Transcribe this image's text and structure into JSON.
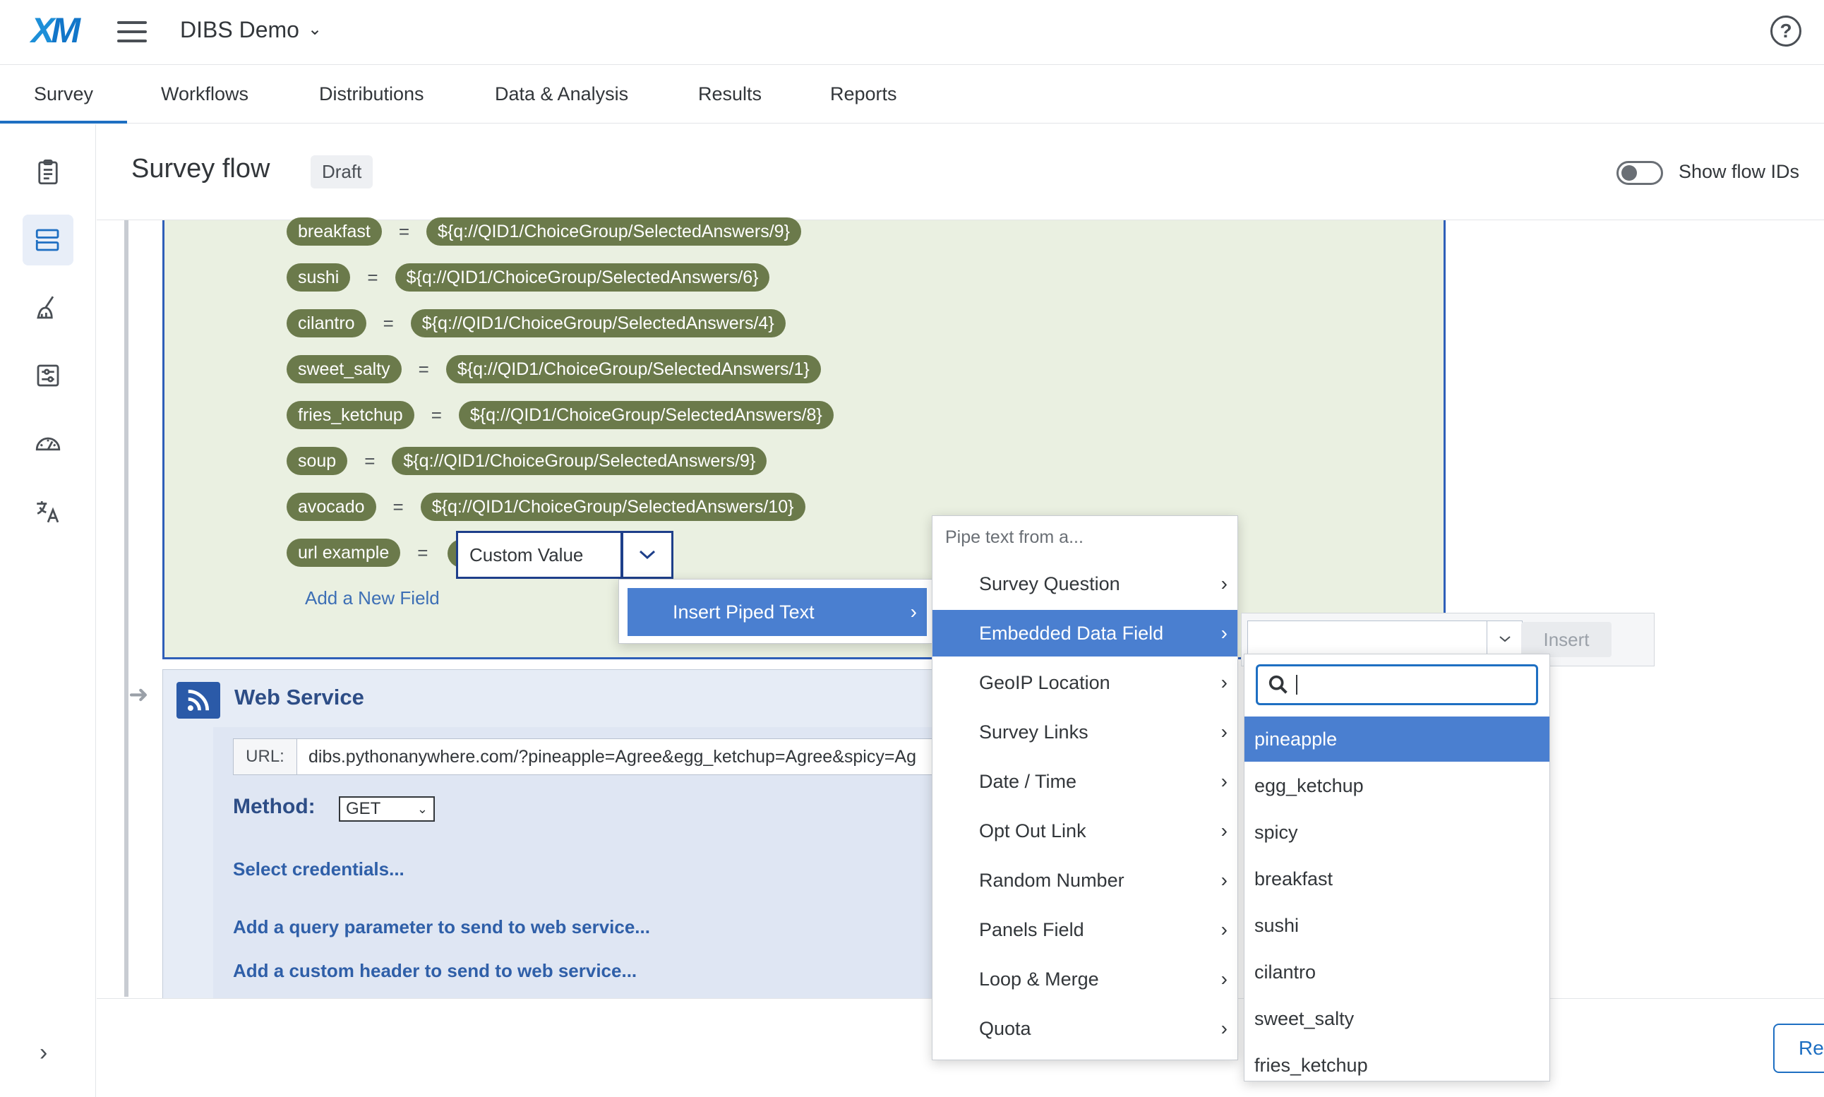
{
  "header": {
    "logo": "XM",
    "project_name": "DIBS Demo",
    "help_label": "?"
  },
  "tabs": [
    "Survey",
    "Workflows",
    "Distributions",
    "Data & Analysis",
    "Results",
    "Reports"
  ],
  "active_tab": "Survey",
  "page": {
    "title": "Survey flow",
    "status_badge": "Draft",
    "toggle_label": "Show flow IDs",
    "toggle_on": false
  },
  "set_embedded": {
    "fields": [
      {
        "name": "breakfast",
        "value": "${q://QID1/ChoiceGroup/SelectedAnswers/9}"
      },
      {
        "name": "sushi",
        "value": "${q://QID1/ChoiceGroup/SelectedAnswers/6}"
      },
      {
        "name": "cilantro",
        "value": "${q://QID1/ChoiceGroup/SelectedAnswers/4}"
      },
      {
        "name": "sweet_salty",
        "value": "${q://QID1/ChoiceGroup/SelectedAnswers/1}"
      },
      {
        "name": "fries_ketchup",
        "value": "${q://QID1/ChoiceGroup/SelectedAnswers/8}"
      },
      {
        "name": "soup",
        "value": "${q://QID1/ChoiceGroup/SelectedAnswers/9}"
      },
      {
        "name": "avocado",
        "value": "${q://QID1/ChoiceGroup/SelectedAnswers/10}"
      }
    ],
    "editing_field": {
      "name": "url example",
      "value": "Custom Value"
    },
    "add_field_label": "Add a New Field"
  },
  "web_service": {
    "title": "Web Service",
    "url_label": "URL:",
    "url_value": "dibs.pythonanywhere.com/?pineapple=Agree&egg_ketchup=Agree&spicy=Ag",
    "method_label": "Method:",
    "method_value": "GET",
    "links": [
      "Select credentials...",
      "Add a query parameter to send to web service...",
      "Add a custom header to send to web service..."
    ]
  },
  "footer": {
    "review_label": "Re"
  },
  "piped_menu": {
    "trigger_label": "Insert Piped Text",
    "header": "Pipe text from a...",
    "items": [
      "Survey Question",
      "Embedded Data Field",
      "GeoIP Location",
      "Survey Links",
      "Date / Time",
      "Opt Out Link",
      "Random Number",
      "Panels Field",
      "Loop & Merge",
      "Quota"
    ],
    "selected": "Embedded Data Field"
  },
  "embedded_picker": {
    "insert_label": "Insert",
    "search_value": "",
    "options": [
      "pineapple",
      "egg_ketchup",
      "spicy",
      "breakfast",
      "sushi",
      "cilantro",
      "sweet_salty",
      "fries_ketchup"
    ],
    "highlighted": "pineapple"
  },
  "colors": {
    "accent": "#1e6fc2",
    "menu_highlight": "#4a7fd0",
    "pill": "#6b7a4b",
    "set_block_bg": "#eaf0e1",
    "web_service_bg": "#e6ecf6"
  }
}
